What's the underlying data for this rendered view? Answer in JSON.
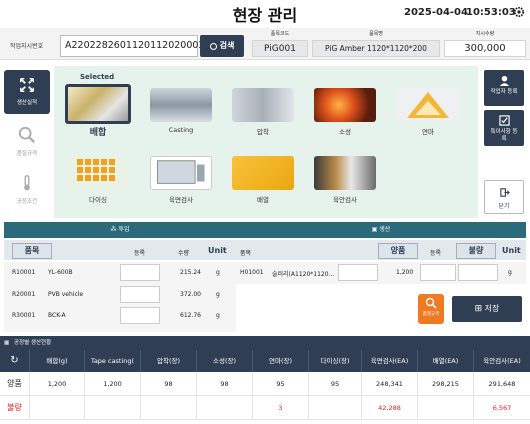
{
  "header": {
    "title": "현장 관리",
    "date": "2025-04-04",
    "time": "10:53:03"
  },
  "order": {
    "label": "작업지시번호",
    "value": "A220228260112011202000З",
    "search_label": "검색",
    "item_code_label": "품목코드",
    "item_code": "PiG001",
    "item_name_label": "품목명",
    "item_name": "PiG  Amber  1120*1120*200",
    "qty_label": "지시수량",
    "qty": "300,000"
  },
  "left_nav": [
    {
      "label": "생산실적",
      "icon": "production-icon"
    },
    {
      "label": "품질규격",
      "icon": "magnifier-icon"
    },
    {
      "label": "공정조건",
      "icon": "thermometer-icon"
    }
  ],
  "categories": {
    "selected_label": "Selected",
    "items": [
      {
        "label": "배합"
      },
      {
        "label": "Casting"
      },
      {
        "label": "압착"
      },
      {
        "label": "소성"
      },
      {
        "label": "연마"
      },
      {
        "label": "다이싱"
      },
      {
        "label": "육면검사"
      },
      {
        "label": "배열"
      },
      {
        "label": "육안검사"
      }
    ]
  },
  "right_buttons": [
    {
      "label": "작업자 등록"
    },
    {
      "label": "특이사항 등록"
    },
    {
      "label": "닫기"
    }
  ],
  "input_section": {
    "title": "투입",
    "col_item": "품목",
    "col_reg": "등록",
    "col_qty": "수량",
    "col_unit": "Unit",
    "rows": [
      {
        "code": "R10001",
        "name": "YL-600B",
        "qty": "215.24",
        "unit": "g"
      },
      {
        "code": "R20001",
        "name": "PVB vehicle",
        "qty": "372.00",
        "unit": "g"
      },
      {
        "code": "R30001",
        "name": "BCK-A",
        "qty": "612.76",
        "unit": "g"
      }
    ]
  },
  "output_section": {
    "title": "생산",
    "col_item": "품목",
    "col_good": "양품",
    "col_reg": "등록",
    "col_bad": "불량",
    "col_unit": "Unit",
    "rows": [
      {
        "code": "H01001",
        "name": "슬러리(A1120*1120...",
        "good": "1,200",
        "unit": "g"
      }
    ],
    "quality_label": "품질규격",
    "save_label": "저장"
  },
  "production_table": {
    "title": "공정별 생산현황",
    "headers": [
      "배합(g)",
      "Tape casting(",
      "압착(장)",
      "소성(장)",
      "연마(장)",
      "다이싱(장)",
      "육면검사(EA)",
      "배열(EA)",
      "육안검사(EA)"
    ],
    "rows": [
      {
        "label": "양품",
        "values": [
          "1,200",
          "1,200",
          "98",
          "98",
          "95",
          "95",
          "248,341",
          "298,215",
          "291,648"
        ]
      },
      {
        "label": "불량",
        "values": [
          "",
          "",
          "",
          "",
          "3",
          "",
          "42,288",
          "",
          "6,567"
        ]
      }
    ]
  },
  "colors": {
    "navy": "#2f3e52",
    "teal": "#2a6a7a",
    "green_panel": "#e6f2ec",
    "orange": "#f07a22",
    "red": "#e02020"
  }
}
